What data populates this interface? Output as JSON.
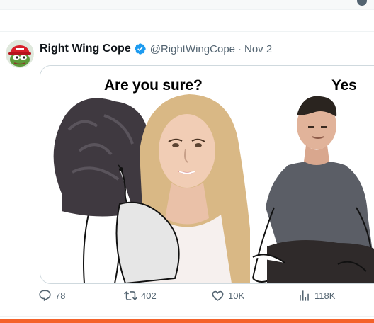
{
  "tweet": {
    "display_name": "Right Wing Cope",
    "handle": "@RightWingCope",
    "separator": "·",
    "date": "Nov 2",
    "avatar_icon": "pepe-maga-hat-avatar",
    "verified_icon": "verified-badge-icon",
    "verified_color": "#1d9bf0"
  },
  "meme": {
    "left_caption": "Are you sure?",
    "right_caption": "Yes"
  },
  "actions": {
    "reply_count": "78",
    "retweet_count": "402",
    "like_count": "10K",
    "view_count": "118K"
  },
  "colors": {
    "text_primary": "#0f1419",
    "text_secondary": "#536471",
    "accent": "#f4622a"
  }
}
